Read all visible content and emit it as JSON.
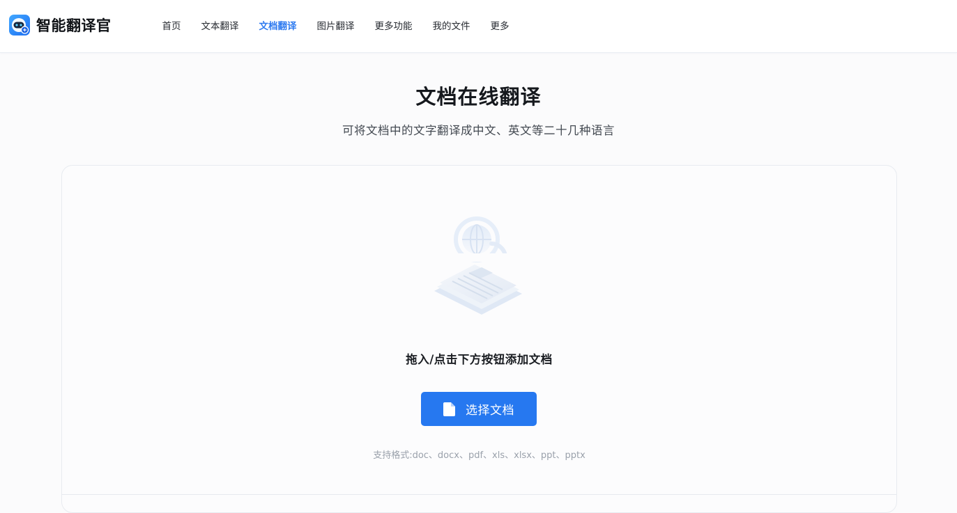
{
  "header": {
    "brand": "智能翻译官",
    "nav": [
      {
        "label": "首页",
        "active": false
      },
      {
        "label": "文本翻译",
        "active": false
      },
      {
        "label": "文档翻译",
        "active": true
      },
      {
        "label": "图片翻译",
        "active": false
      },
      {
        "label": "更多功能",
        "active": false
      },
      {
        "label": "我的文件",
        "active": false
      },
      {
        "label": "更多",
        "active": false
      }
    ]
  },
  "main": {
    "title": "文档在线翻译",
    "subtitle": "可将文档中的文字翻译成中文、英文等二十几种语言"
  },
  "upload": {
    "illustration_icon": "globe-document-icon",
    "hint": "拖入/点击下方按钮添加文档",
    "button_icon": "file-icon",
    "button_label": "选择文档",
    "formats": "支持格式:doc、docx、pdf、xls、xlsx、ppt、pptx"
  },
  "colors": {
    "accent": "#2678f0",
    "nav_active": "#2f7bf0",
    "page_bg": "#fbfbfc"
  }
}
